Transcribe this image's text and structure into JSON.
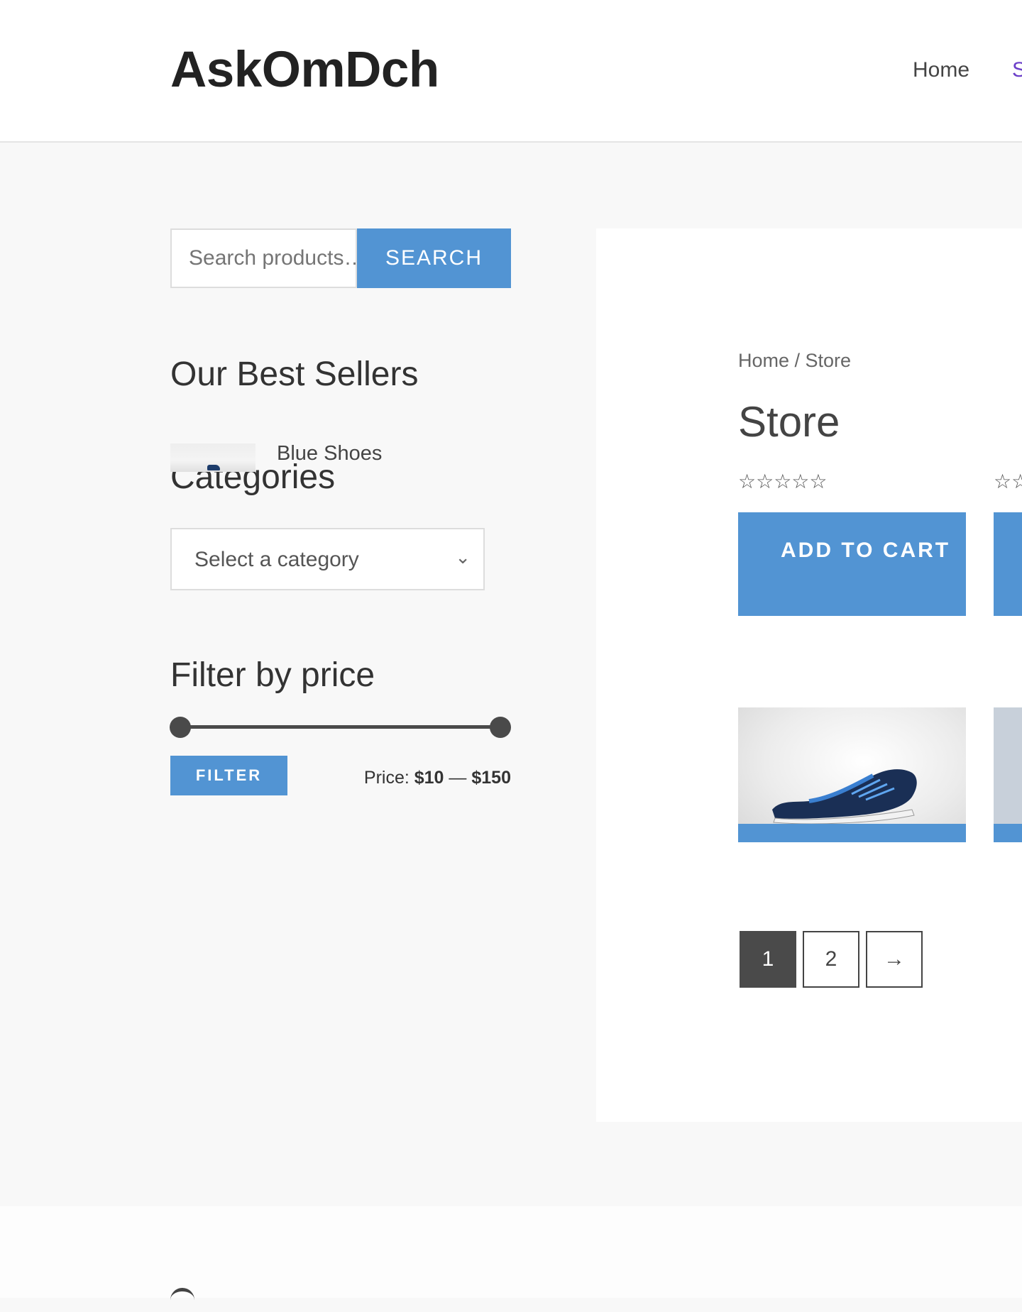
{
  "header": {
    "site_title": "AskOmDch",
    "nav": [
      "Home",
      "S"
    ]
  },
  "sidebar": {
    "search": {
      "placeholder": "Search products…",
      "button_label": "SEARCH"
    },
    "best_sellers": {
      "title": "Our Best Sellers",
      "items": [
        "Blue Shoes"
      ]
    },
    "categories": {
      "title": "Categories",
      "selected": "Select a category"
    },
    "price_filter": {
      "title": "Filter by price",
      "button_label": "FILTER",
      "price_prefix": "Price:",
      "min": "$10",
      "separator": "—",
      "max": "$150"
    }
  },
  "main": {
    "breadcrumb": "Home / Store",
    "title": "Store",
    "products": [
      {
        "rating_stars": "☆☆☆☆☆",
        "button_label": "ADD TO CART"
      },
      {
        "rating_stars": "☆☆",
        "button_label": ""
      }
    ],
    "pagination": [
      "1",
      "2",
      "→"
    ]
  },
  "colors": {
    "accent": "#5294d3",
    "nav_active": "#6b3fc9",
    "dark": "#4a4a4a"
  }
}
